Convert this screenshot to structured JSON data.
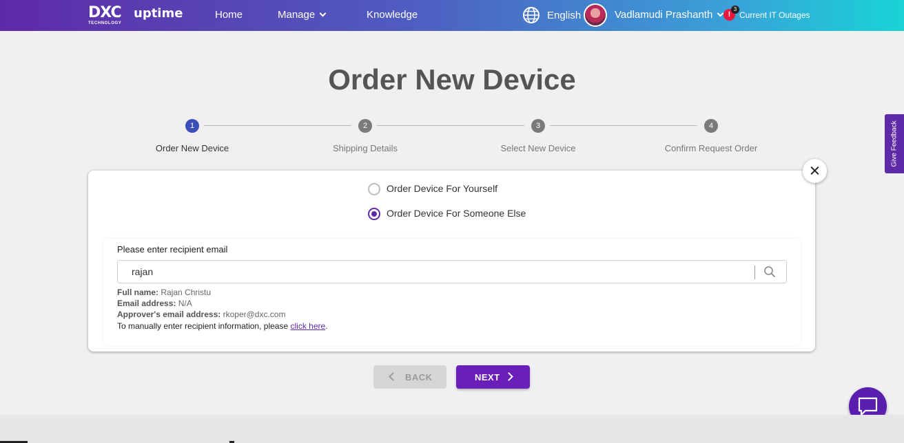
{
  "header": {
    "logo_text": "DXC",
    "logo_subtext": "TECHNOLOGY",
    "app_name": "uptime",
    "nav": [
      {
        "label": "Home"
      },
      {
        "label": "Manage"
      },
      {
        "label": "Knowledge"
      }
    ],
    "language": "English",
    "user_name": "Vadlamudi Prashanth",
    "alert_icon": "!",
    "alert_count": "3",
    "outages_label": "Current IT Outages"
  },
  "page": {
    "title": "Order New Device"
  },
  "stepper": {
    "steps": [
      {
        "number": "1",
        "label": "Order New Device",
        "active": true
      },
      {
        "number": "2",
        "label": "Shipping Details",
        "active": false
      },
      {
        "number": "3",
        "label": "Select New Device",
        "active": false
      },
      {
        "number": "4",
        "label": "Confirm Request Order",
        "active": false
      }
    ]
  },
  "order_for": {
    "options": [
      {
        "label": "Order Device For Yourself",
        "checked": false
      },
      {
        "label": "Order Device For Someone Else",
        "checked": true
      }
    ]
  },
  "recipient": {
    "field_label": "Please enter recipient email",
    "input_value": "rajan",
    "full_name_label": "Full name:",
    "full_name": "Rajan Christu",
    "email_label": "Email address:",
    "email": "N/A",
    "approver_label": "Approver's email address:",
    "approver_email": "rkoper@dxc.com",
    "manual_text": "To manually enter recipient information, please",
    "manual_link": "click here",
    "manual_suffix": "."
  },
  "buttons": {
    "back": "BACK",
    "next": "NEXT"
  },
  "feedback": {
    "label": "Give Feedback"
  },
  "colors": {
    "brand_purple": "#5f2aa8",
    "next_button": "#6a1fb8",
    "step_active": "#3f4fb8",
    "alert_red": "#e8193c"
  }
}
